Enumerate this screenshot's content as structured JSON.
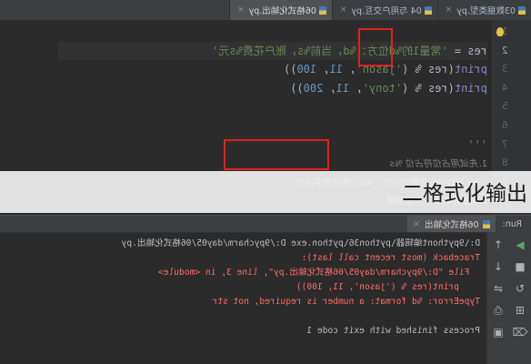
{
  "tabs": [
    {
      "label": "03数据类型.py",
      "active": false
    },
    {
      "label": "04 与用户交互.py",
      "active": false
    },
    {
      "label": "06格式化输出.py",
      "active": true
    }
  ],
  "editor": {
    "lines": [
      {
        "n": "1",
        "segments": []
      },
      {
        "n": "2",
        "segments": [
          [
            "kw",
            "res = "
          ],
          [
            "str",
            "'常量1的%d位方：%d，当前%s，账户花费%s元'"
          ]
        ]
      },
      {
        "n": "3",
        "segments": [
          [
            "fn",
            "print"
          ],
          [
            "kw",
            "(res % ("
          ],
          [
            "str",
            "'jason'"
          ],
          [
            "kw",
            ", "
          ],
          [
            "num",
            "11"
          ],
          [
            "kw",
            ", "
          ],
          [
            "num",
            "100"
          ],
          [
            "kw",
            "))"
          ]
        ]
      },
      {
        "n": "4",
        "segments": [
          [
            "fn",
            "print"
          ],
          [
            "kw",
            "(res % ("
          ],
          [
            "str",
            "'tony'"
          ],
          [
            "kw",
            ", "
          ],
          [
            "num",
            "11"
          ],
          [
            "kw",
            ", "
          ],
          [
            "num",
            "200"
          ],
          [
            "kw",
            "))"
          ]
        ]
      },
      {
        "n": "5",
        "segments": []
      },
      {
        "n": "6",
        "segments": []
      },
      {
        "n": "7",
        "segments": [
          [
            "str",
            "'''"
          ]
        ]
      },
      {
        "n": "8",
        "segments": [
          [
            "cmt",
            "1.先试用占位符占位 %s"
          ]
        ]
      },
      {
        "n": "9",
        "segments": [
          [
            "cmt",
            "   %s可以给任意数据占位；%d只能给数字占位"
          ]
        ]
      },
      {
        "n": "10",
        "segments": [
          [
            "cmt",
            "2.格式化输出---对应替换"
          ]
        ]
      }
    ]
  },
  "run": {
    "label": "Run:",
    "tab": "06格式化输出",
    "console": [
      {
        "t": "norm",
        "text": "D:\\9pythont编辑器\\python36\\python.exe D:/9pycharm/day05/06格式化输出.py"
      },
      {
        "t": "err",
        "text": "Traceback (most recent call last):"
      },
      {
        "t": "err",
        "text": "  File \"D:/9pycharm/day05/06格式化输出.py\", line 3, in <module>"
      },
      {
        "t": "err",
        "text": "    print(res % ('jason', 11, 100))"
      },
      {
        "t": "err",
        "text": "TypeError: %d format: a number is required, not str"
      },
      {
        "t": "norm",
        "text": ""
      },
      {
        "t": "norm",
        "text": "Process finished with exit code 1"
      }
    ]
  },
  "overlay": {
    "caption": "二格式化输出"
  },
  "colors": {
    "highlight_box": "#e0211d",
    "error_text": "#ff6b68"
  },
  "icons": [
    "python-file-icon",
    "close-icon",
    "lightbulb-icon",
    "run-icon",
    "rerun-icon",
    "stop-icon",
    "scroll-up-icon",
    "scroll-down-icon",
    "soft-wrap-icon",
    "print-icon",
    "trash-icon",
    "pin-icon"
  ]
}
